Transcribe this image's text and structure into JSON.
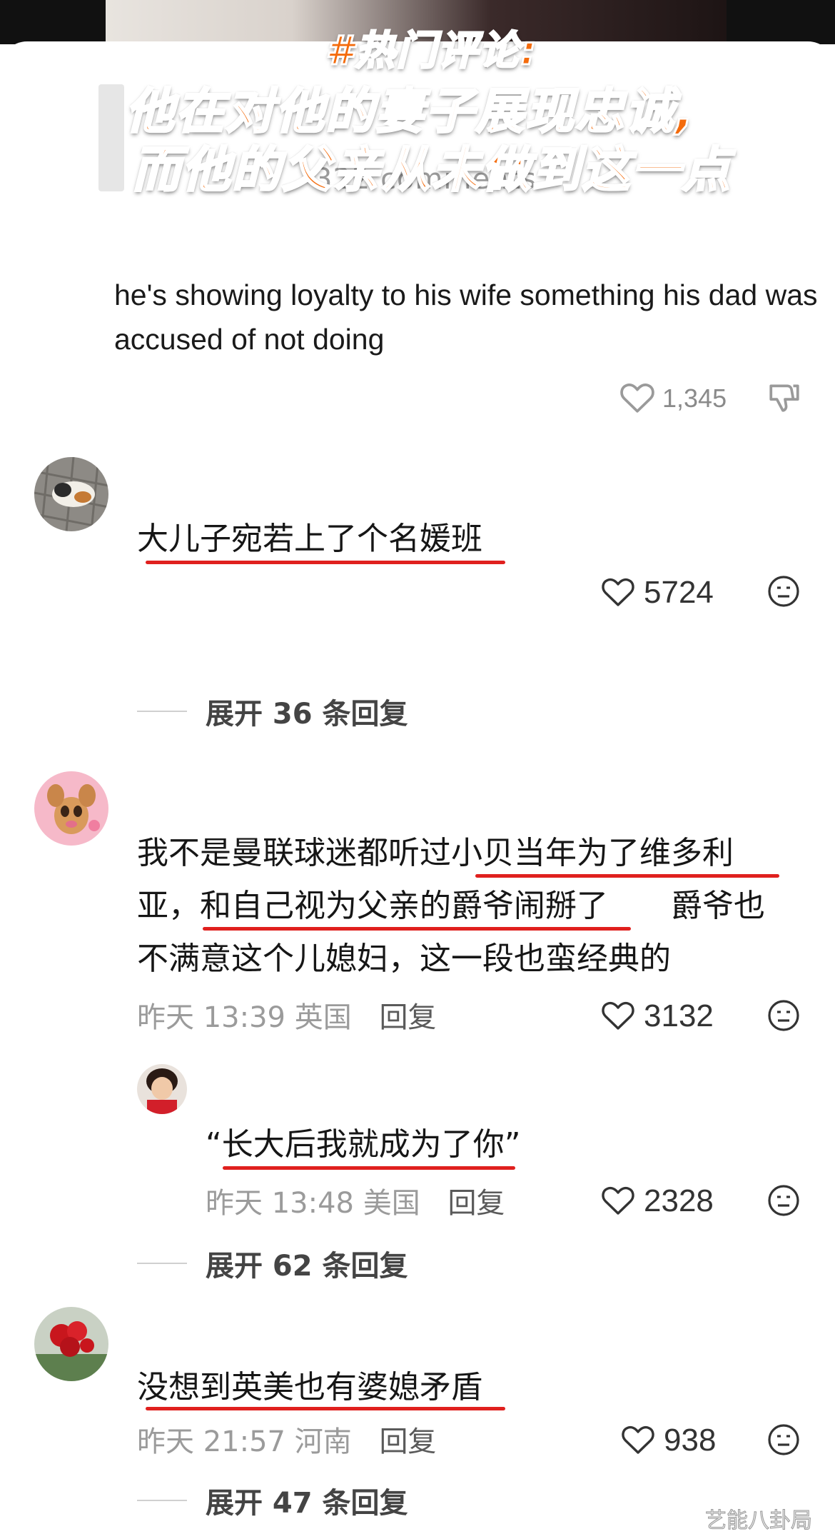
{
  "overlay": {
    "line1": "#热门评论:",
    "line2": "他在对他的妻子展现忠诚,",
    "line3": "而他的父亲从未做到这一点"
  },
  "background_fragment": {
    "comments_label": "322 comments"
  },
  "quoted_comment": {
    "text": "he's showing loyalty to his wife something his dad was accused of not doing",
    "likes": "1,345"
  },
  "comments": [
    {
      "avatar": "cat-on-brick-avatar",
      "text": "大儿子宛若上了个名媛班",
      "likes": "5724",
      "expand_label": "展开 36 条回复"
    },
    {
      "avatar": "cartoon-deer-avatar",
      "text_line1": "我不是曼联球迷都听过小贝当年为了维多利",
      "text_line2": "亚，和自己视为父亲的爵爷闹掰了　　爵爷也",
      "text_line3": "不满意这个儿媳妇，这一段也蛮经典的",
      "time": "昨天 13:39",
      "location": "英国",
      "reply_label": "回复",
      "likes": "3132",
      "reply": {
        "avatar": "child-avatar",
        "text": "“长大后我就成为了你”",
        "time": "昨天 13:48",
        "location": "美国",
        "reply_label": "回复",
        "likes": "2328"
      },
      "expand_label": "展开 62 条回复"
    },
    {
      "avatar": "red-flower-avatar",
      "text": "没想到英美也有婆媳矛盾",
      "time": "昨天 21:57",
      "location": "河南",
      "reply_label": "回复",
      "likes": "938",
      "expand_label": "展开 47 条回复"
    }
  ],
  "watermark": "艺能八卦局",
  "colors": {
    "overlay_text": "#f46b0c",
    "underline": "#e0201e",
    "meta": "#9b9b9b"
  }
}
